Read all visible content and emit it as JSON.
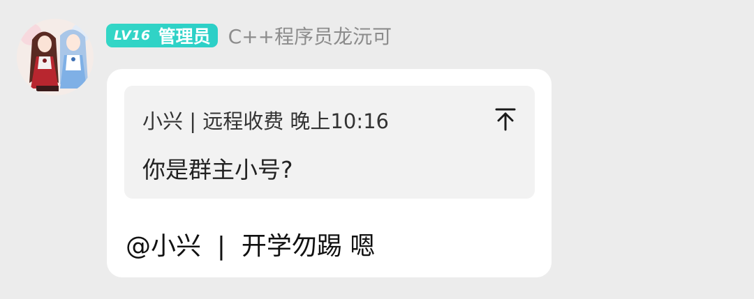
{
  "sender": {
    "avatar": "anime-girls-avatar",
    "badge_level": "LV16",
    "badge_role": "管理员",
    "badge_color": "#2fd3c6",
    "name": "C++程序员龙沅可"
  },
  "message": {
    "quote": {
      "meta": "小兴 | 远程收费 晚上10:16",
      "text": "你是群主小号?",
      "jump_icon": "jump-to-original-icon"
    },
    "reply": "@小兴  |  开学勿踢 嗯"
  }
}
